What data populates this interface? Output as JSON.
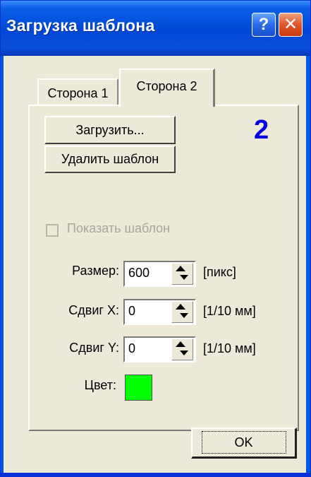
{
  "window": {
    "title": "Загрузка шаблона",
    "help_label": "?",
    "close_label": "✕"
  },
  "tabs": [
    {
      "label": "Сторона 1",
      "selected": false
    },
    {
      "label": "Сторона 2",
      "selected": true
    }
  ],
  "side_number": "2",
  "buttons": {
    "load_label": "Загрузить...",
    "delete_label": "Удалить шаблон",
    "ok_label": "OK"
  },
  "show_template": {
    "label": "Показать шаблон",
    "checked": false,
    "enabled": false
  },
  "fields": {
    "size": {
      "label": "Размер:",
      "value": "600",
      "unit": "[пикс]"
    },
    "shift_x": {
      "label": "Сдвиг X:",
      "value": "0",
      "unit": "[1/10 мм]"
    },
    "shift_y": {
      "label": "Сдвиг Y:",
      "value": "0",
      "unit": "[1/10 мм]"
    }
  },
  "color": {
    "label": "Цвет:",
    "value": "#00ff00"
  },
  "colors": {
    "title_bar": "#0a5fe6",
    "dialog_bg": "#ece9d8",
    "side_number": "#0000e0",
    "close_button": "#e0552a"
  }
}
